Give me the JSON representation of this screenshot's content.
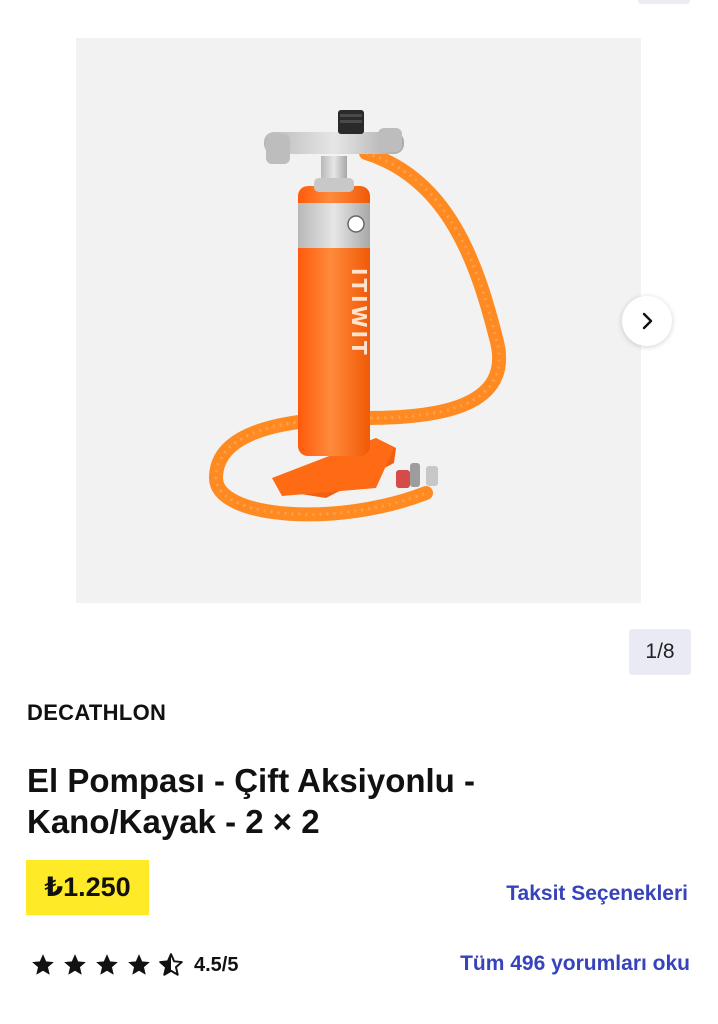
{
  "gallery": {
    "image_alt": "El Pompası - Çift Aksiyonlu",
    "pump_print": "ITIWIT",
    "counter": "1/8",
    "next_icon": "chevron-right-icon"
  },
  "product": {
    "brand": "DECATHLON",
    "title": "El Pompası - Çift Aksiyonlu - Kano/Kayak - 2 × 2",
    "price": "₺1.250",
    "installments_label": "Taksit Seçenekleri",
    "rating": {
      "value": 4.5,
      "max": 5,
      "label": "4.5/5"
    },
    "reviews_link": "Tüm 496 yorumları oku"
  },
  "colors": {
    "accent": "#3643ba",
    "price_bg": "#ffea28",
    "pump_orange": "#ff6a14"
  }
}
